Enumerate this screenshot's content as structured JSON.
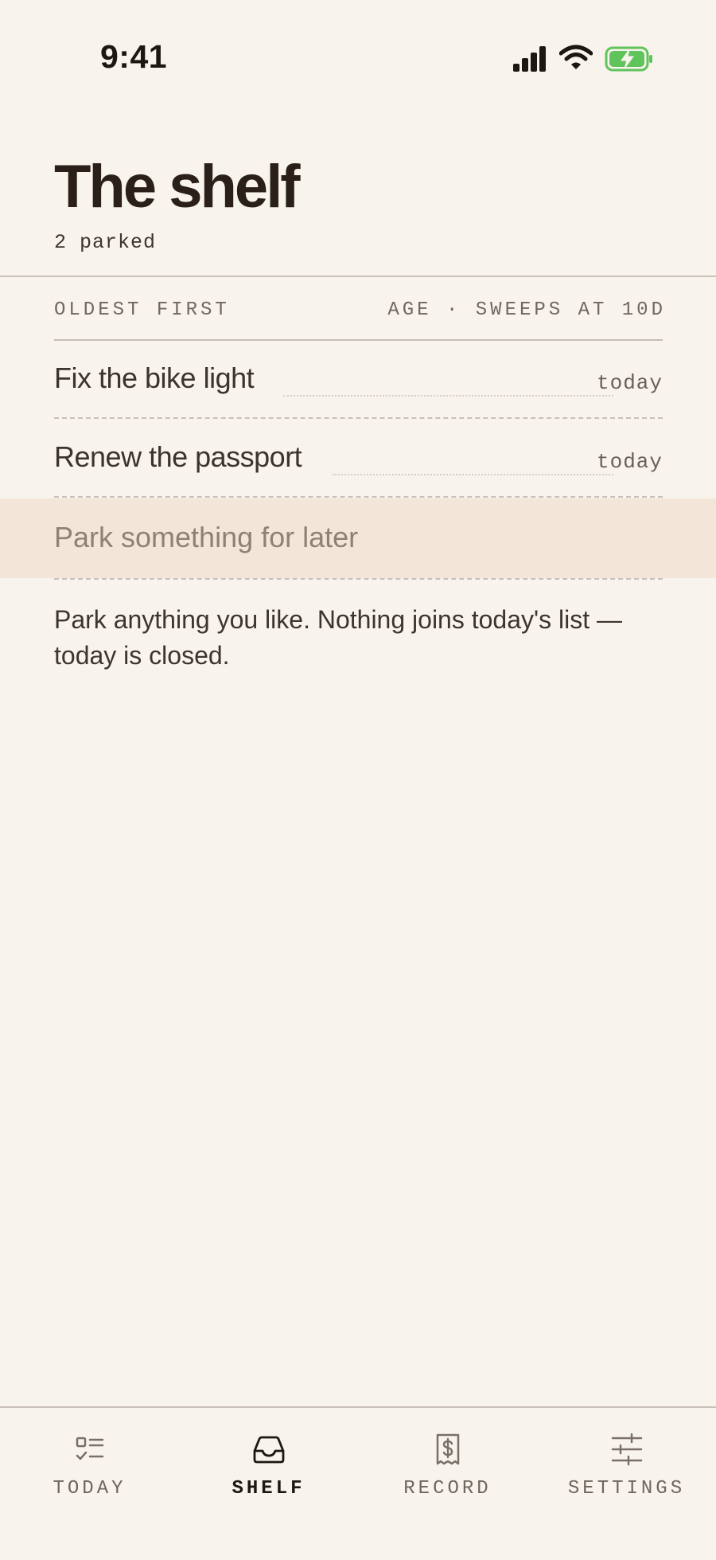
{
  "status_bar": {
    "time": "9:41"
  },
  "header": {
    "title": "The shelf",
    "subtitle": "2 parked"
  },
  "list": {
    "sort_label": "OLDEST FIRST",
    "age_label": "AGE · SWEEPS AT 10D",
    "items": [
      {
        "title": "Fix the bike light",
        "age": "today"
      },
      {
        "title": "Renew the passport",
        "age": "today"
      }
    ]
  },
  "add_item": {
    "placeholder": "Park something for later"
  },
  "note": "Park anything you like. Nothing joins today's list — today is closed.",
  "tabs": [
    {
      "label": "TODAY",
      "icon": "checklist-icon",
      "active": false
    },
    {
      "label": "SHELF",
      "icon": "inbox-tray-icon",
      "active": true
    },
    {
      "label": "RECORD",
      "icon": "receipt-dollar-icon",
      "active": false
    },
    {
      "label": "SETTINGS",
      "icon": "sliders-icon",
      "active": false
    }
  ],
  "colors": {
    "background": "#f8f3ed",
    "input_highlight": "#f3e6d8",
    "battery_green": "#5fc45a"
  }
}
